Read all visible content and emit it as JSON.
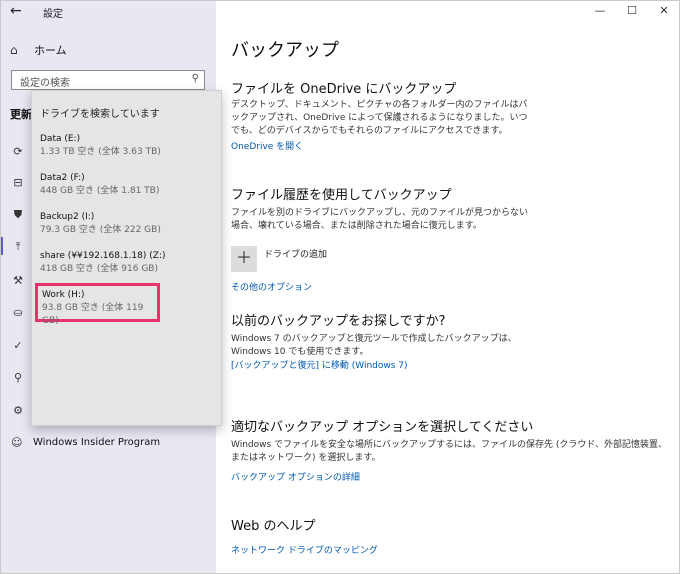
{
  "window": {
    "title": "設定",
    "controls": [
      "—",
      "☐",
      "✕"
    ]
  },
  "sidebar": {
    "home_label": "ホーム",
    "search_placeholder": "設定の検索",
    "section_label": "更新",
    "icons": [
      "sync-icon",
      "delivery-icon",
      "shield-icon",
      "backup-icon",
      "wrench-icon",
      "person-icon",
      "activation-icon",
      "find-device-icon",
      "developer-icon"
    ],
    "bottom_item_label": "Windows Insider Program"
  },
  "dropdown": {
    "title": "ドライブを検索しています",
    "drives": [
      {
        "name": "Data (E:)",
        "space": "1.33 TB 空き (全体 3.63 TB)"
      },
      {
        "name": "Data2 (F:)",
        "space": "448 GB 空き (全体 1.81 TB)"
      },
      {
        "name": "Backup2 (I:)",
        "space": "79.3 GB 空き (全体 222 GB)"
      },
      {
        "name": "share (¥¥192.168.1.18) (Z:)",
        "space": "418 GB 空き (全体 916 GB)"
      },
      {
        "name": "Work (H:)",
        "space": "93.8 GB 空き (全体 119 GB)"
      }
    ]
  },
  "main": {
    "page_title": "バックアップ",
    "onedrive": {
      "heading": "ファイルを OneDrive にバックアップ",
      "body": "デスクトップ、ドキュメント、ピクチャの各フォルダー内のファイルはバックアップされ、OneDrive によって保護されるようになりました。いつでも、どのデバイスからでもそれらのファイルにアクセスできます。",
      "link": "OneDrive を開く"
    },
    "history": {
      "heading": "ファイル履歴を使用してバックアップ",
      "body": "ファイルを別のドライブにバックアップし、元のファイルが見つからない場合、壊れている場合、または削除された場合に復元します。",
      "add_drive_label": "ドライブの追加",
      "more_options_link": "その他のオプション"
    },
    "older": {
      "heading": "以前のバックアップをお探しですか?",
      "body": "Windows 7 のバックアップと復元ツールで作成したバックアップは、Windows 10 でも使用できます。",
      "link": "[バックアップと復元] に移動 (Windows 7)"
    },
    "right_option": {
      "heading": "適切なバックアップ オプションを選択してください",
      "body": "Windows でファイルを安全な場所にバックアップするには、ファイルの保存先 (クラウド、外部記憶装置、またはネットワーク) を選択します。",
      "link": "バックアップ オプションの詳細"
    },
    "web_help": {
      "heading": "Web のヘルプ",
      "link": "ネットワーク ドライブのマッピング"
    }
  }
}
